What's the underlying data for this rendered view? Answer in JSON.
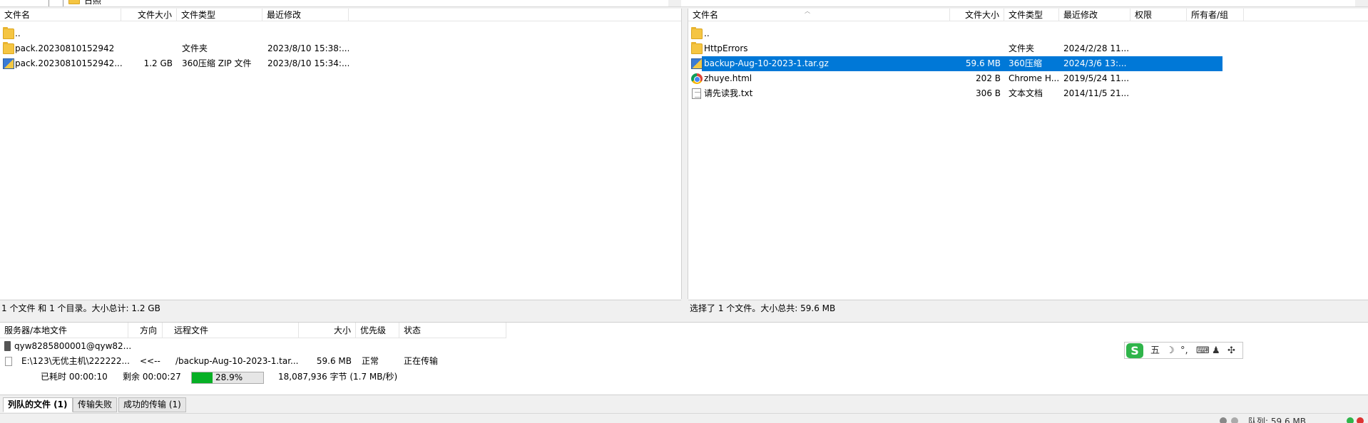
{
  "top_tree": {
    "label": "日照"
  },
  "local": {
    "columns": {
      "name": "文件名",
      "size": "文件大小",
      "type": "文件类型",
      "modified": "最近修改"
    },
    "rows": [
      {
        "name": "..",
        "size": "",
        "type": "",
        "modified": "",
        "icon": "folder-icon"
      },
      {
        "name": "pack.20230810152942",
        "size": "",
        "type": "文件夹",
        "modified": "2023/8/10 15:38:...",
        "icon": "folder-icon"
      },
      {
        "name": "pack.20230810152942....",
        "size": "1.2 GB",
        "type": "360压缩 ZIP 文件",
        "modified": "2023/8/10 15:34:...",
        "icon": "zip-icon"
      }
    ],
    "status": "1 个文件 和 1 个目录。大小总计: 1.2 GB"
  },
  "remote": {
    "columns": {
      "name": "文件名",
      "size": "文件大小",
      "type": "文件类型",
      "modified": "最近修改",
      "perm": "权限",
      "owner": "所有者/组"
    },
    "rows": [
      {
        "name": "..",
        "size": "",
        "type": "",
        "modified": "",
        "icon": "folder-icon"
      },
      {
        "name": "HttpErrors",
        "size": "",
        "type": "文件夹",
        "modified": "2024/2/28 11...",
        "icon": "folder-icon"
      },
      {
        "name": "backup-Aug-10-2023-1.tar.gz",
        "size": "59.6 MB",
        "type": "360压缩",
        "modified": "2024/3/6 13:...",
        "icon": "zip-icon",
        "selected": true
      },
      {
        "name": "zhuye.html",
        "size": "202 B",
        "type": "Chrome H...",
        "modified": "2019/5/24 11...",
        "icon": "chrome-icon"
      },
      {
        "name": "请先读我.txt",
        "size": "306 B",
        "type": "文本文档",
        "modified": "2014/11/5 21...",
        "icon": "text-file-icon"
      }
    ],
    "status": "选择了 1 个文件。大小总共: 59.6 MB"
  },
  "queue": {
    "columns": {
      "server": "服务器/本地文件",
      "direction": "方向",
      "remote": "远程文件",
      "size": "大小",
      "priority": "优先级",
      "state": "状态"
    },
    "server": "qyw8285800001@qyw82...",
    "transfer": {
      "local": "E:\\123\\无优主机\\222222...",
      "direction": "<<--",
      "remote": "/backup-Aug-10-2023-1.tar...",
      "size": "59.6 MB",
      "priority": "正常",
      "state": "正在传输"
    },
    "elapsed": "已耗时 00:00:10",
    "remaining": "剩余 00:00:27",
    "progress_percent": 28.9,
    "progress_label": "28.9%",
    "bytes": "18,087,936 字节 (1.7 MB/秒)"
  },
  "ime": {
    "logo": "S",
    "mode": "五",
    "items": [
      "☽",
      "°,",
      "⌨",
      "♟",
      "✣"
    ]
  },
  "tabs": [
    {
      "label": "列队的文件 (1)",
      "active": true
    },
    {
      "label": "传输失败",
      "active": false
    },
    {
      "label": "成功的传输 (1)",
      "active": false
    }
  ],
  "bottom": {
    "queue_label": "队列: 59.6 MB"
  }
}
